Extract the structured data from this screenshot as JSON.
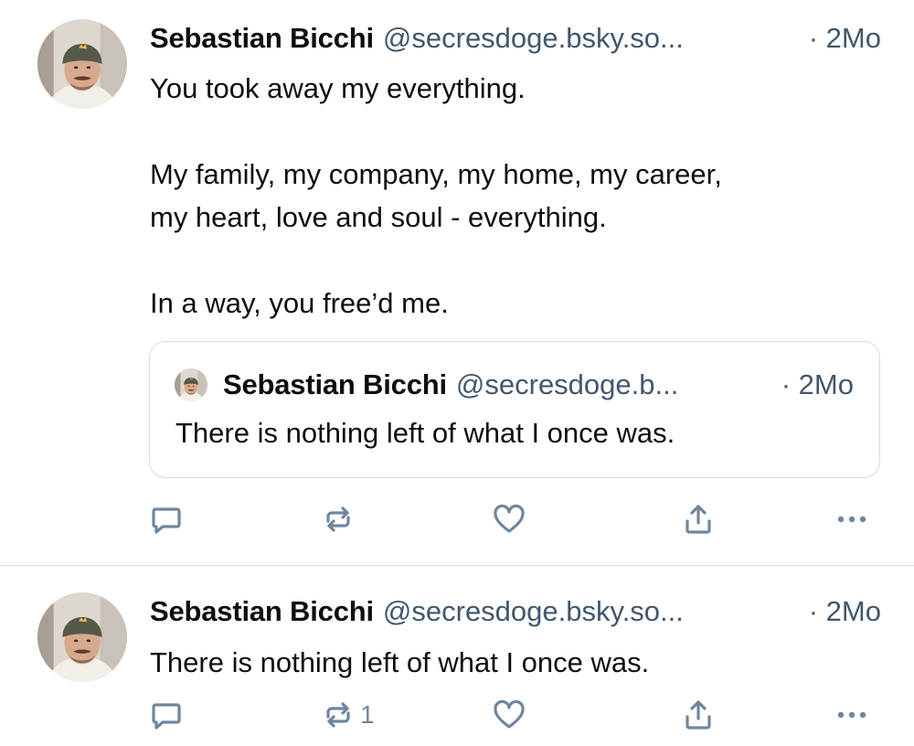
{
  "posts": [
    {
      "author": {
        "name": "Sebastian Bicchi",
        "handle": "@secresdoge.bsky.so...",
        "avatar": "avatar-photo"
      },
      "time": "· 2Mo",
      "text": {
        "line1": "You took away my everything.",
        "line2": "My family, my company, my home, my career,",
        "line3": "my heart, love and soul - everything.",
        "line4": "In a way, you free’d me."
      },
      "quote": {
        "author_name": "Sebastian Bicchi",
        "author_handle": "@secresdoge.b...",
        "time": "· 2Mo",
        "text": "There is nothing left of what I once was."
      },
      "actions": {
        "reply_icon": "reply-icon",
        "repost_icon": "repost-icon",
        "like_icon": "heart-icon",
        "share_icon": "share-icon",
        "more_icon": "more-icon",
        "repost_count": ""
      }
    },
    {
      "author": {
        "name": "Sebastian Bicchi",
        "handle": "@secresdoge.bsky.so...",
        "avatar": "avatar-photo"
      },
      "time": "· 2Mo",
      "text": {
        "line1": "There is nothing left of what I once was."
      },
      "actions": {
        "reply_icon": "reply-icon",
        "repost_icon": "repost-icon",
        "like_icon": "heart-icon",
        "share_icon": "share-icon",
        "more_icon": "more-icon",
        "repost_count": "1"
      }
    }
  ],
  "colors": {
    "text": "#0b0f14",
    "secondary": "#42576c",
    "icon": "#6f869f",
    "border": "#d4dbe2"
  }
}
